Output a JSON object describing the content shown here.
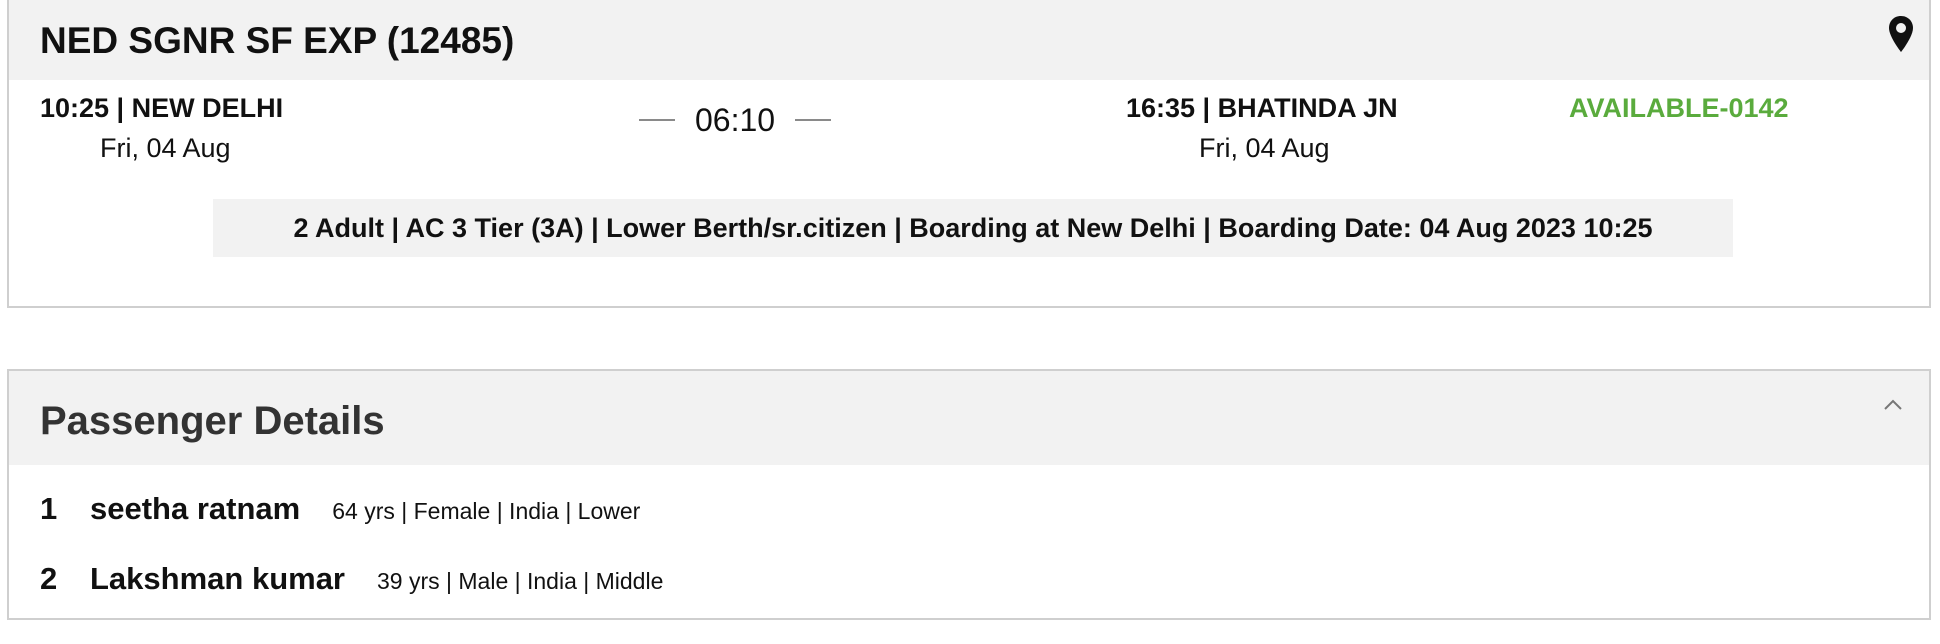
{
  "train": {
    "title": "NED SGNR SF EXP (12485)",
    "icon": "map-pin-icon",
    "departure": {
      "line": "10:25 | NEW DELHI",
      "date": "Fri, 04 Aug"
    },
    "duration": "06:10",
    "arrival": {
      "line": "16:35 | BHATINDA JN",
      "date": "Fri, 04 Aug"
    },
    "availability": "AVAILABLE-0142",
    "availability_color": "#5aab3d",
    "journey_info": "2 Adult | AC 3 Tier (3A) | Lower Berth/sr.citizen | Boarding at New Delhi | Boarding Date: 04 Aug 2023 10:25"
  },
  "passengers": {
    "title": "Passenger Details",
    "toggle_icon": "chevron-up-icon",
    "list": [
      {
        "index": "1",
        "name": "seetha ratnam",
        "details": "64 yrs | Female | India | Lower"
      },
      {
        "index": "2",
        "name": "Lakshman kumar",
        "details": "39 yrs | Male | India | Middle"
      }
    ]
  }
}
